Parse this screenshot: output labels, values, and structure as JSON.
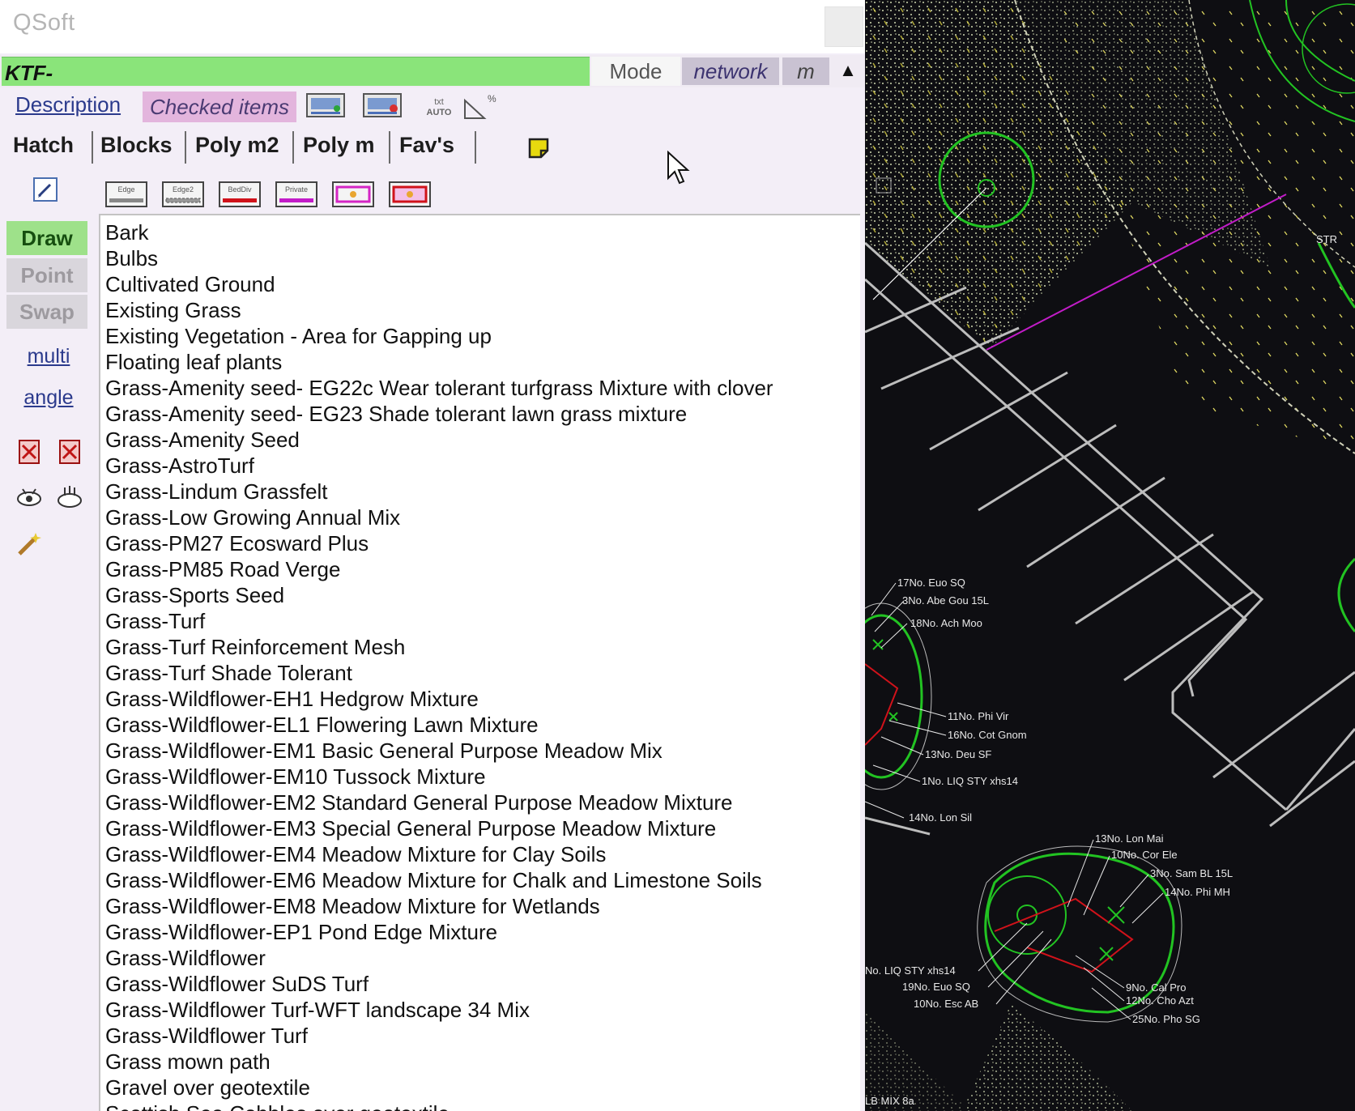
{
  "app_title": "QSoft",
  "mode_bar": {
    "field_value": "KTF-",
    "mode_label": "Mode",
    "network_label": "network",
    "unit_label": "m",
    "collapse_glyph": "▲"
  },
  "top_row": {
    "description_link": "Description",
    "checked_items_label": "Checked items"
  },
  "tabs": [
    {
      "label": "Hatch"
    },
    {
      "label": "Blocks"
    },
    {
      "label": "Poly m2"
    },
    {
      "label": "Poly m"
    },
    {
      "label": "Fav's"
    }
  ],
  "icon_row": {
    "buttons": [
      {
        "label": "Edge"
      },
      {
        "label": "Edge2"
      },
      {
        "label": "BedDiv"
      },
      {
        "label": "Private"
      }
    ]
  },
  "side_panel": {
    "draw_label": "Draw",
    "point_label": "Point",
    "swap_label": "Swap",
    "multi_link": "multi",
    "angle_link": "angle"
  },
  "hatch_list": [
    "Bark",
    "Bulbs",
    "Cultivated Ground",
    "Existing Grass",
    "Existing Vegetation - Area for Gapping up",
    "Floating leaf plants",
    "Grass-Amenity seed- EG22c Wear tolerant turfgrass Mixture with clover",
    "Grass-Amenity seed- EG23 Shade tolerant lawn grass mixture",
    "Grass-Amenity Seed",
    "Grass-AstroTurf",
    "Grass-Lindum Grassfelt",
    "Grass-Low Growing Annual Mix",
    "Grass-PM27 Ecosward Plus",
    "Grass-PM85 Road Verge",
    "Grass-Sports Seed",
    "Grass-Turf",
    "Grass-Turf Reinforcement Mesh",
    "Grass-Turf Shade Tolerant",
    "Grass-Wildflower-EH1 Hedgrow Mixture",
    "Grass-Wildflower-EL1 Flowering Lawn Mixture",
    "Grass-Wildflower-EM1 Basic General Purpose Meadow Mix",
    "Grass-Wildflower-EM10 Tussock Mixture",
    "Grass-Wildflower-EM2 Standard General Purpose Meadow Mixture",
    "Grass-Wildflower-EM3 Special General Purpose Meadow Mixture",
    "Grass-Wildflower-EM4 Meadow Mixture for Clay Soils",
    "Grass-Wildflower-EM6 Meadow Mixture for Chalk and Limestone Soils",
    "Grass-Wildflower-EM8 Meadow Mixture for Wetlands",
    "Grass-Wildflower-EP1 Pond Edge Mixture",
    "Grass-Wildflower",
    "Grass-Wildflower SuDS Turf",
    "Grass-Wildflower Turf-WFT landscape 34 Mix",
    "Grass-Wildflower Turf",
    "Grass mown path",
    "Gravel over geotextile",
    "Scottish Sea Cobbles over geotextile"
  ],
  "cad_labels": [
    "STR",
    "17No. Euo SQ",
    "3No. Abe Gou 15L",
    "18No. Ach Moo",
    "11No. Phi Vir",
    "16No. Cot Gnom",
    "13No. Deu SF",
    "1No. LIQ STY xhs14",
    "14No. Lon Sil",
    "13No. Lon Mai",
    "10No. Cor Ele",
    "3No. Sam BL 15L",
    "14No. Phi MH",
    "No. LIQ STY xhs14",
    "19No. Euo SQ",
    "10No. Esc AB",
    "9No. Cal Pro",
    "12No. Cho Azt",
    "25No. Pho SG",
    "LB MIX 8a"
  ],
  "colors": {
    "field_green": "#8ae47a",
    "draw_green": "#9ee18a",
    "checked_pink": "#e3b5dd",
    "network_grey": "#c9c2d2",
    "cad_background": "#0e0e12",
    "cad_green": "#22c322",
    "cad_red": "#d0121a",
    "cad_magenta": "#c21cc8"
  }
}
